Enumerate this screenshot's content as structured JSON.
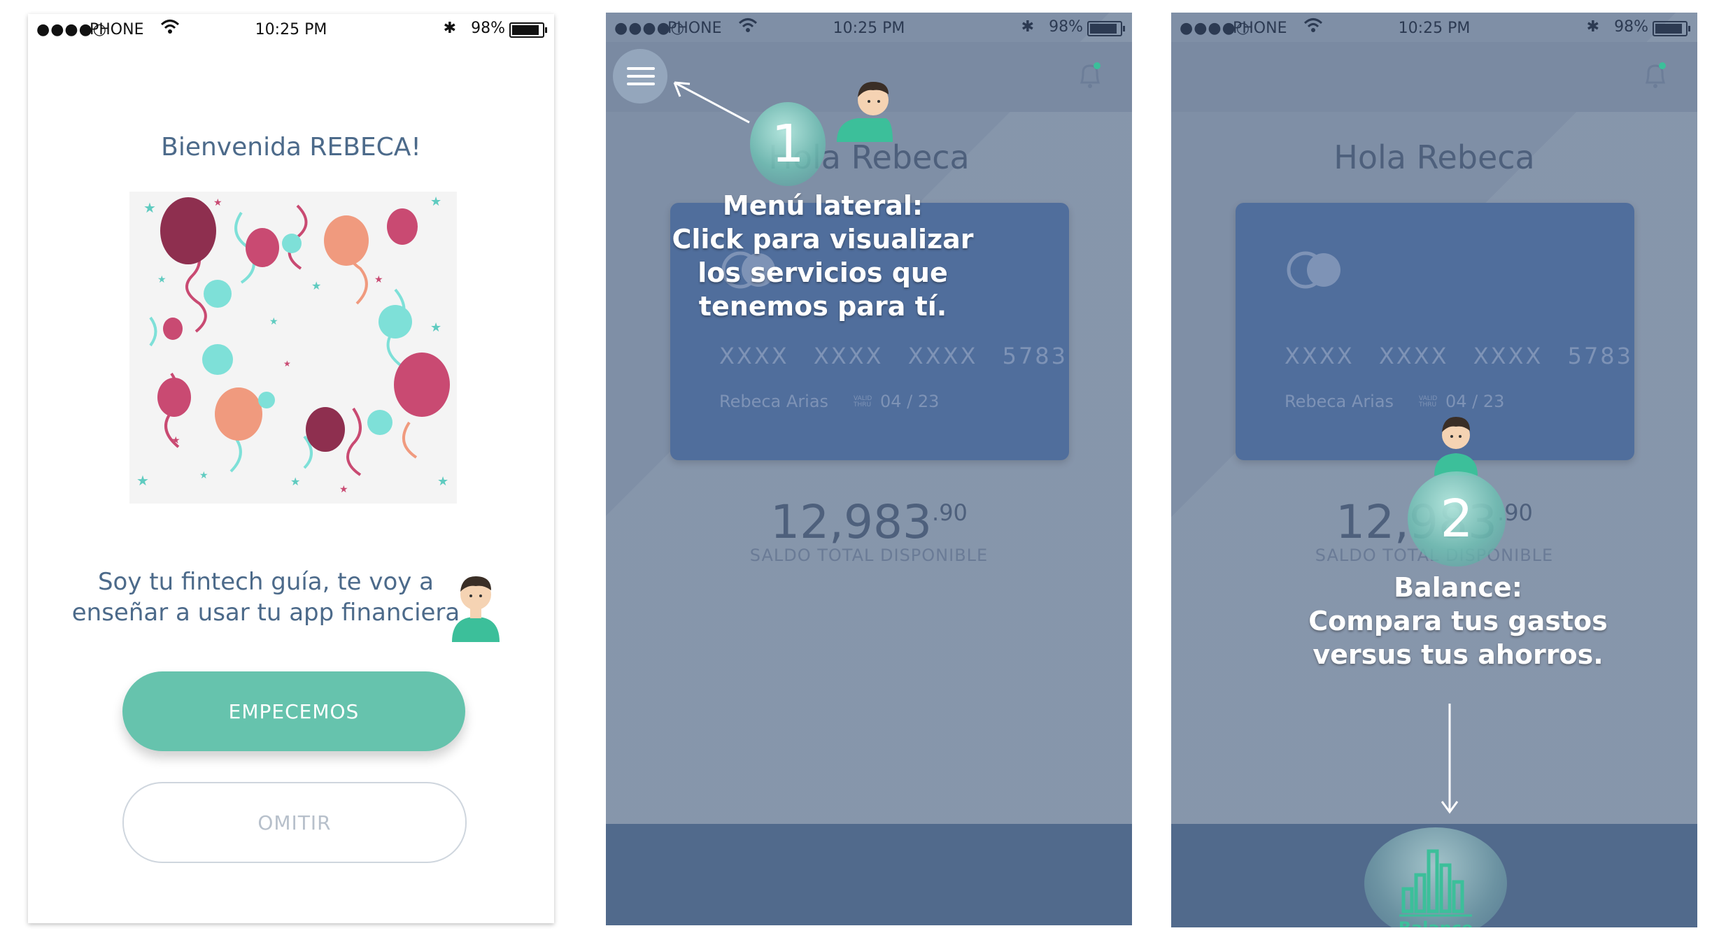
{
  "status_bar": {
    "signal": "●●●●○",
    "carrier": "PHONE",
    "time": "10:25 PM",
    "battery": "98%"
  },
  "onboarding": {
    "welcome": "Bienvenida REBECA!",
    "guide_line1": "Soy tu fintech guía, te voy a",
    "guide_line2": "enseñar a usar tu app financiera",
    "start_button": "EMPECEMOS",
    "skip_button": "OMITIR"
  },
  "home": {
    "greeting": "Hola Rebeca",
    "card": {
      "number_groups": [
        "XXXX",
        "XXXX",
        "XXXX",
        "5783"
      ],
      "holder": "Rebeca Arias",
      "valid_thru_line1": "VALID",
      "valid_thru_line2": "THRU",
      "expiry": "04 / 23"
    },
    "balance_integer": "12,983",
    "balance_cents": ".90",
    "balance_label": "SALDO TOTAL DISPONIBLE"
  },
  "tour_step_1": {
    "number": "1",
    "line1": "Menú lateral:",
    "line2": "Click para visualizar",
    "line3": "los servicios que",
    "line4": "tenemos para tí."
  },
  "tour_step_2": {
    "number": "2",
    "line1": "Balance:",
    "line2": "Compara tus gastos",
    "line3": "versus tus ahorros.",
    "tab_label": "Balance"
  },
  "colors": {
    "accent": "#66c3ad",
    "overlay": "#7f8fa6",
    "card": "#506e9c",
    "text": "#4c6a8a"
  }
}
